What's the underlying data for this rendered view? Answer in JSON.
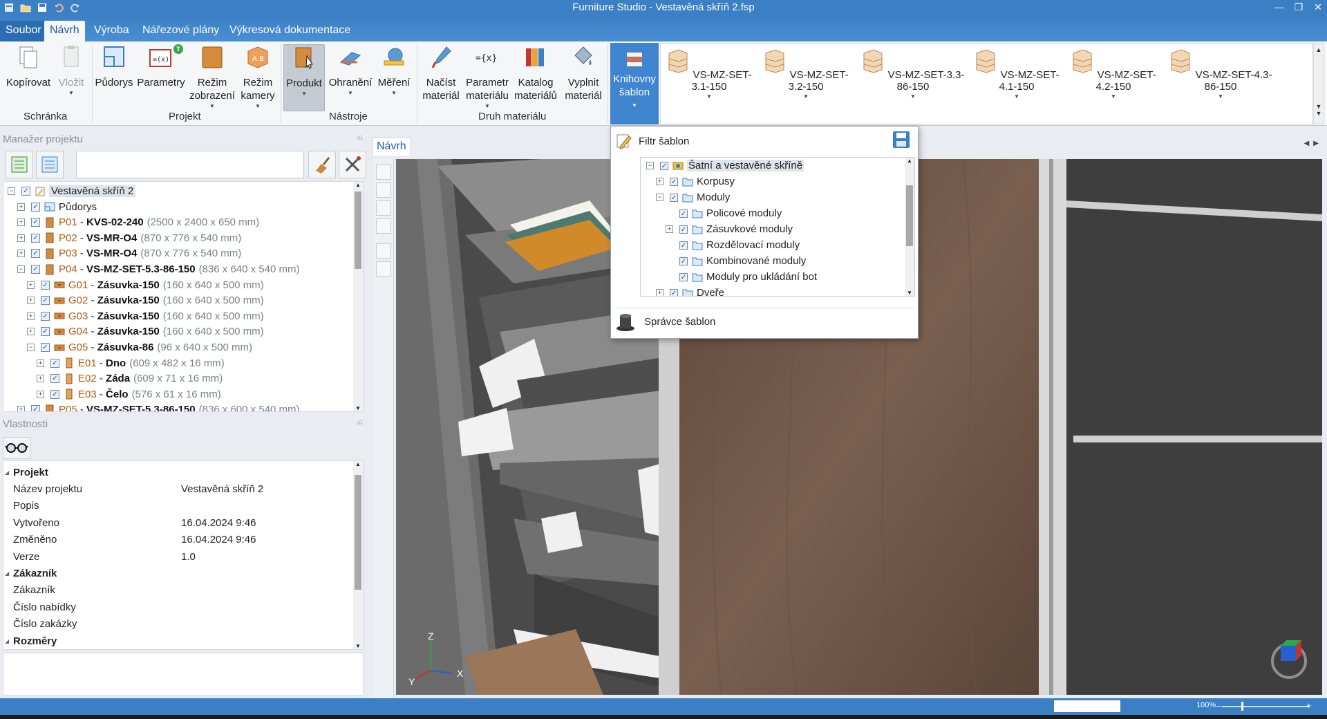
{
  "window": {
    "title": "Furniture Studio - Vestavěná skříň  2.fsp",
    "qat_icons": [
      "app-menu-icon",
      "open-icon",
      "save-icon",
      "undo-icon",
      "redo-icon"
    ],
    "controls": [
      "minimize-icon",
      "restore-icon",
      "close-icon"
    ]
  },
  "ribbon_tabs": [
    "Soubor",
    "Návrh",
    "Výroba",
    "Nářezové plány",
    "Výkresová dokumentace"
  ],
  "ribbon": {
    "clipboard": {
      "copy": "Kopírovat",
      "paste": "Vložit",
      "group": "Schránka"
    },
    "project": {
      "floorplans": "Půdorys",
      "parameters": "Parametry",
      "params_badge": "T",
      "display_mode": [
        "Režim",
        "zobrazení"
      ],
      "camera_mode": [
        "Režim",
        "kamery"
      ],
      "group": "Projekt"
    },
    "tools": {
      "product": "Produkt",
      "edging": "Ohranění",
      "measure": "Měření",
      "group": "Nástroje"
    },
    "material": {
      "load": [
        "Načíst",
        "materiál"
      ],
      "param": [
        "Parametr",
        "materiálu"
      ],
      "catalog": [
        "Katalog",
        "materiálů"
      ],
      "fill": [
        "Vyplnit",
        "materiál"
      ],
      "group": "Druh materiálu"
    },
    "templates": {
      "library": [
        "Knihovny",
        "šablon"
      ],
      "gallery": [
        "VS-MZ-SET-3.1-150",
        "VS-MZ-SET-3.2-150",
        "VS-MZ-SET-3.3-86-150",
        "VS-MZ-SET-4.1-150",
        "VS-MZ-SET-4.2-150",
        "VS-MZ-SET-4.3-86-150"
      ]
    }
  },
  "project_manager": {
    "header": "Manažer projektu",
    "tree": [
      {
        "level": 0,
        "name": "Vestavěná skříň  2",
        "kind": "project"
      },
      {
        "level": 1,
        "name": "Půdorys",
        "kind": "plan"
      },
      {
        "level": 1,
        "id": "P01",
        "name": "KVS-02-240",
        "dim": "(2500 x 2400 x 650 mm)",
        "kind": "part"
      },
      {
        "level": 1,
        "id": "P02",
        "name": "VS-MR-O4",
        "dim": "(870 x 776 x 540 mm)",
        "kind": "part"
      },
      {
        "level": 1,
        "id": "P03",
        "name": "VS-MR-O4",
        "dim": "(870 x 776 x 540 mm)",
        "kind": "part"
      },
      {
        "level": 1,
        "id": "P04",
        "name": "VS-MZ-SET-5.3-86-150",
        "dim": "(836 x 640 x 540 mm)",
        "kind": "part"
      },
      {
        "level": 2,
        "id": "G01",
        "name": "Zásuvka-150",
        "dim": "(160 x 640 x 500 mm)",
        "kind": "drawer"
      },
      {
        "level": 2,
        "id": "G02",
        "name": "Zásuvka-150",
        "dim": "(160 x 640 x 500 mm)",
        "kind": "drawer"
      },
      {
        "level": 2,
        "id": "G03",
        "name": "Zásuvka-150",
        "dim": "(160 x 640 x 500 mm)",
        "kind": "drawer"
      },
      {
        "level": 2,
        "id": "G04",
        "name": "Zásuvka-150",
        "dim": "(160 x 640 x 500 mm)",
        "kind": "drawer"
      },
      {
        "level": 2,
        "id": "G05",
        "name": "Zásuvka-86",
        "dim": "(96 x 640 x 500 mm)",
        "kind": "drawer"
      },
      {
        "level": 3,
        "id": "E01",
        "name": "Dno",
        "dim": "(609 x 482 x 16 mm)",
        "kind": "board"
      },
      {
        "level": 3,
        "id": "E02",
        "name": "Záda",
        "dim": "(609 x 71 x 16 mm)",
        "kind": "board"
      },
      {
        "level": 3,
        "id": "E03",
        "name": "Čelo",
        "dim": "(576 x 61 x 16 mm)",
        "kind": "board"
      },
      {
        "level": 1,
        "id": "P05",
        "name": "VS-MZ-SET-5.3-86-150",
        "dim": "(836 x 600 x 540 mm)",
        "kind": "part"
      }
    ]
  },
  "properties": {
    "header": "Vlastnosti",
    "rows": [
      {
        "cat": true,
        "k": "Projekt"
      },
      {
        "k": "Název projektu",
        "v": "Vestavěná skříň  2"
      },
      {
        "k": "Popis",
        "v": ""
      },
      {
        "k": "Vytvořeno",
        "v": "16.04.2024 9:46"
      },
      {
        "k": "Změněno",
        "v": "16.04.2024 9:46"
      },
      {
        "k": "Verze",
        "v": "1.0"
      },
      {
        "cat": true,
        "k": "Zákazník"
      },
      {
        "k": "Zákazník",
        "v": ""
      },
      {
        "k": "Číslo nabídky",
        "v": ""
      },
      {
        "k": "Číslo zakázky",
        "v": ""
      },
      {
        "cat": true,
        "k": "Rozměry"
      }
    ]
  },
  "viewport": {
    "tab": "Návrh",
    "axes": {
      "z": "Z",
      "x": "X",
      "y": "Y"
    }
  },
  "template_dropdown": {
    "filter_label": "Filtr šablon",
    "tree": [
      {
        "level": 0,
        "label": "Šatní a vestavěné skříně",
        "exp": "−"
      },
      {
        "level": 1,
        "label": "Korpusy",
        "exp": "+"
      },
      {
        "level": 1,
        "label": "Moduly",
        "exp": "−"
      },
      {
        "level": 2,
        "label": "Policové moduly",
        "exp": ""
      },
      {
        "level": 2,
        "label": "Zásuvkové moduly",
        "exp": "+"
      },
      {
        "level": 2,
        "label": "Rozdělovací moduly",
        "exp": ""
      },
      {
        "level": 2,
        "label": "Kombinované moduly",
        "exp": ""
      },
      {
        "level": 2,
        "label": "Moduly pro ukládání bot",
        "exp": ""
      },
      {
        "level": 1,
        "label": "Dveře",
        "exp": "+"
      }
    ],
    "manager_label": "Správce šablon"
  },
  "statusbar": {
    "zoom": "100%"
  },
  "colors": {
    "accent": "#3b7fc4",
    "tree_id": "#b35a12",
    "wood": "#6b5344"
  }
}
